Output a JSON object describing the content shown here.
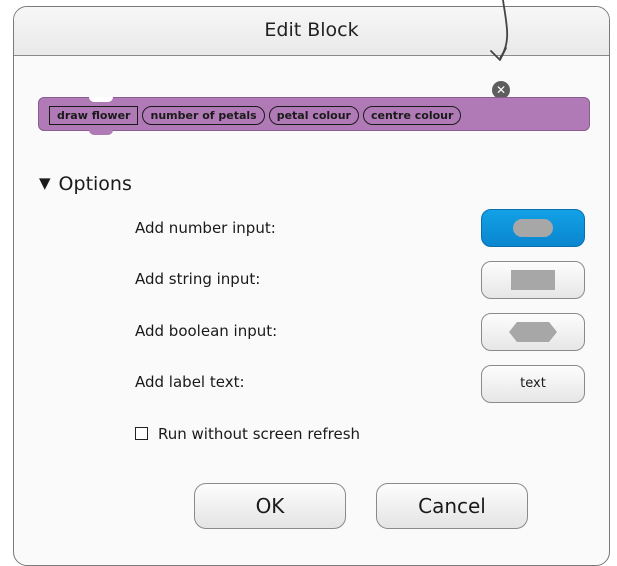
{
  "dialog": {
    "title": "Edit Block"
  },
  "block": {
    "color": "#b07ab6",
    "name": "draw flower",
    "params": [
      "number of petals",
      "petal colour",
      "centre colour"
    ]
  },
  "close_icon": {
    "glyph": "✕"
  },
  "options": {
    "header": "Options",
    "toggle_glyph": "▼",
    "rows": [
      {
        "label": "Add number input:",
        "shape": "pill-shape-icon",
        "selected": true
      },
      {
        "label": "Add string input:",
        "shape": "rectangle-shape-icon",
        "selected": false
      },
      {
        "label": "Add boolean input:",
        "shape": "hexagon-shape-icon",
        "selected": false
      },
      {
        "label": "Add label text:",
        "button_text": "text",
        "selected": false
      }
    ],
    "run_without_refresh": {
      "label": "Run without screen refresh",
      "checked": false
    }
  },
  "buttons": {
    "ok": "OK",
    "cancel": "Cancel"
  },
  "colors": {
    "accent_selected": "#0a86cf",
    "block_purple": "#b07ab6"
  }
}
